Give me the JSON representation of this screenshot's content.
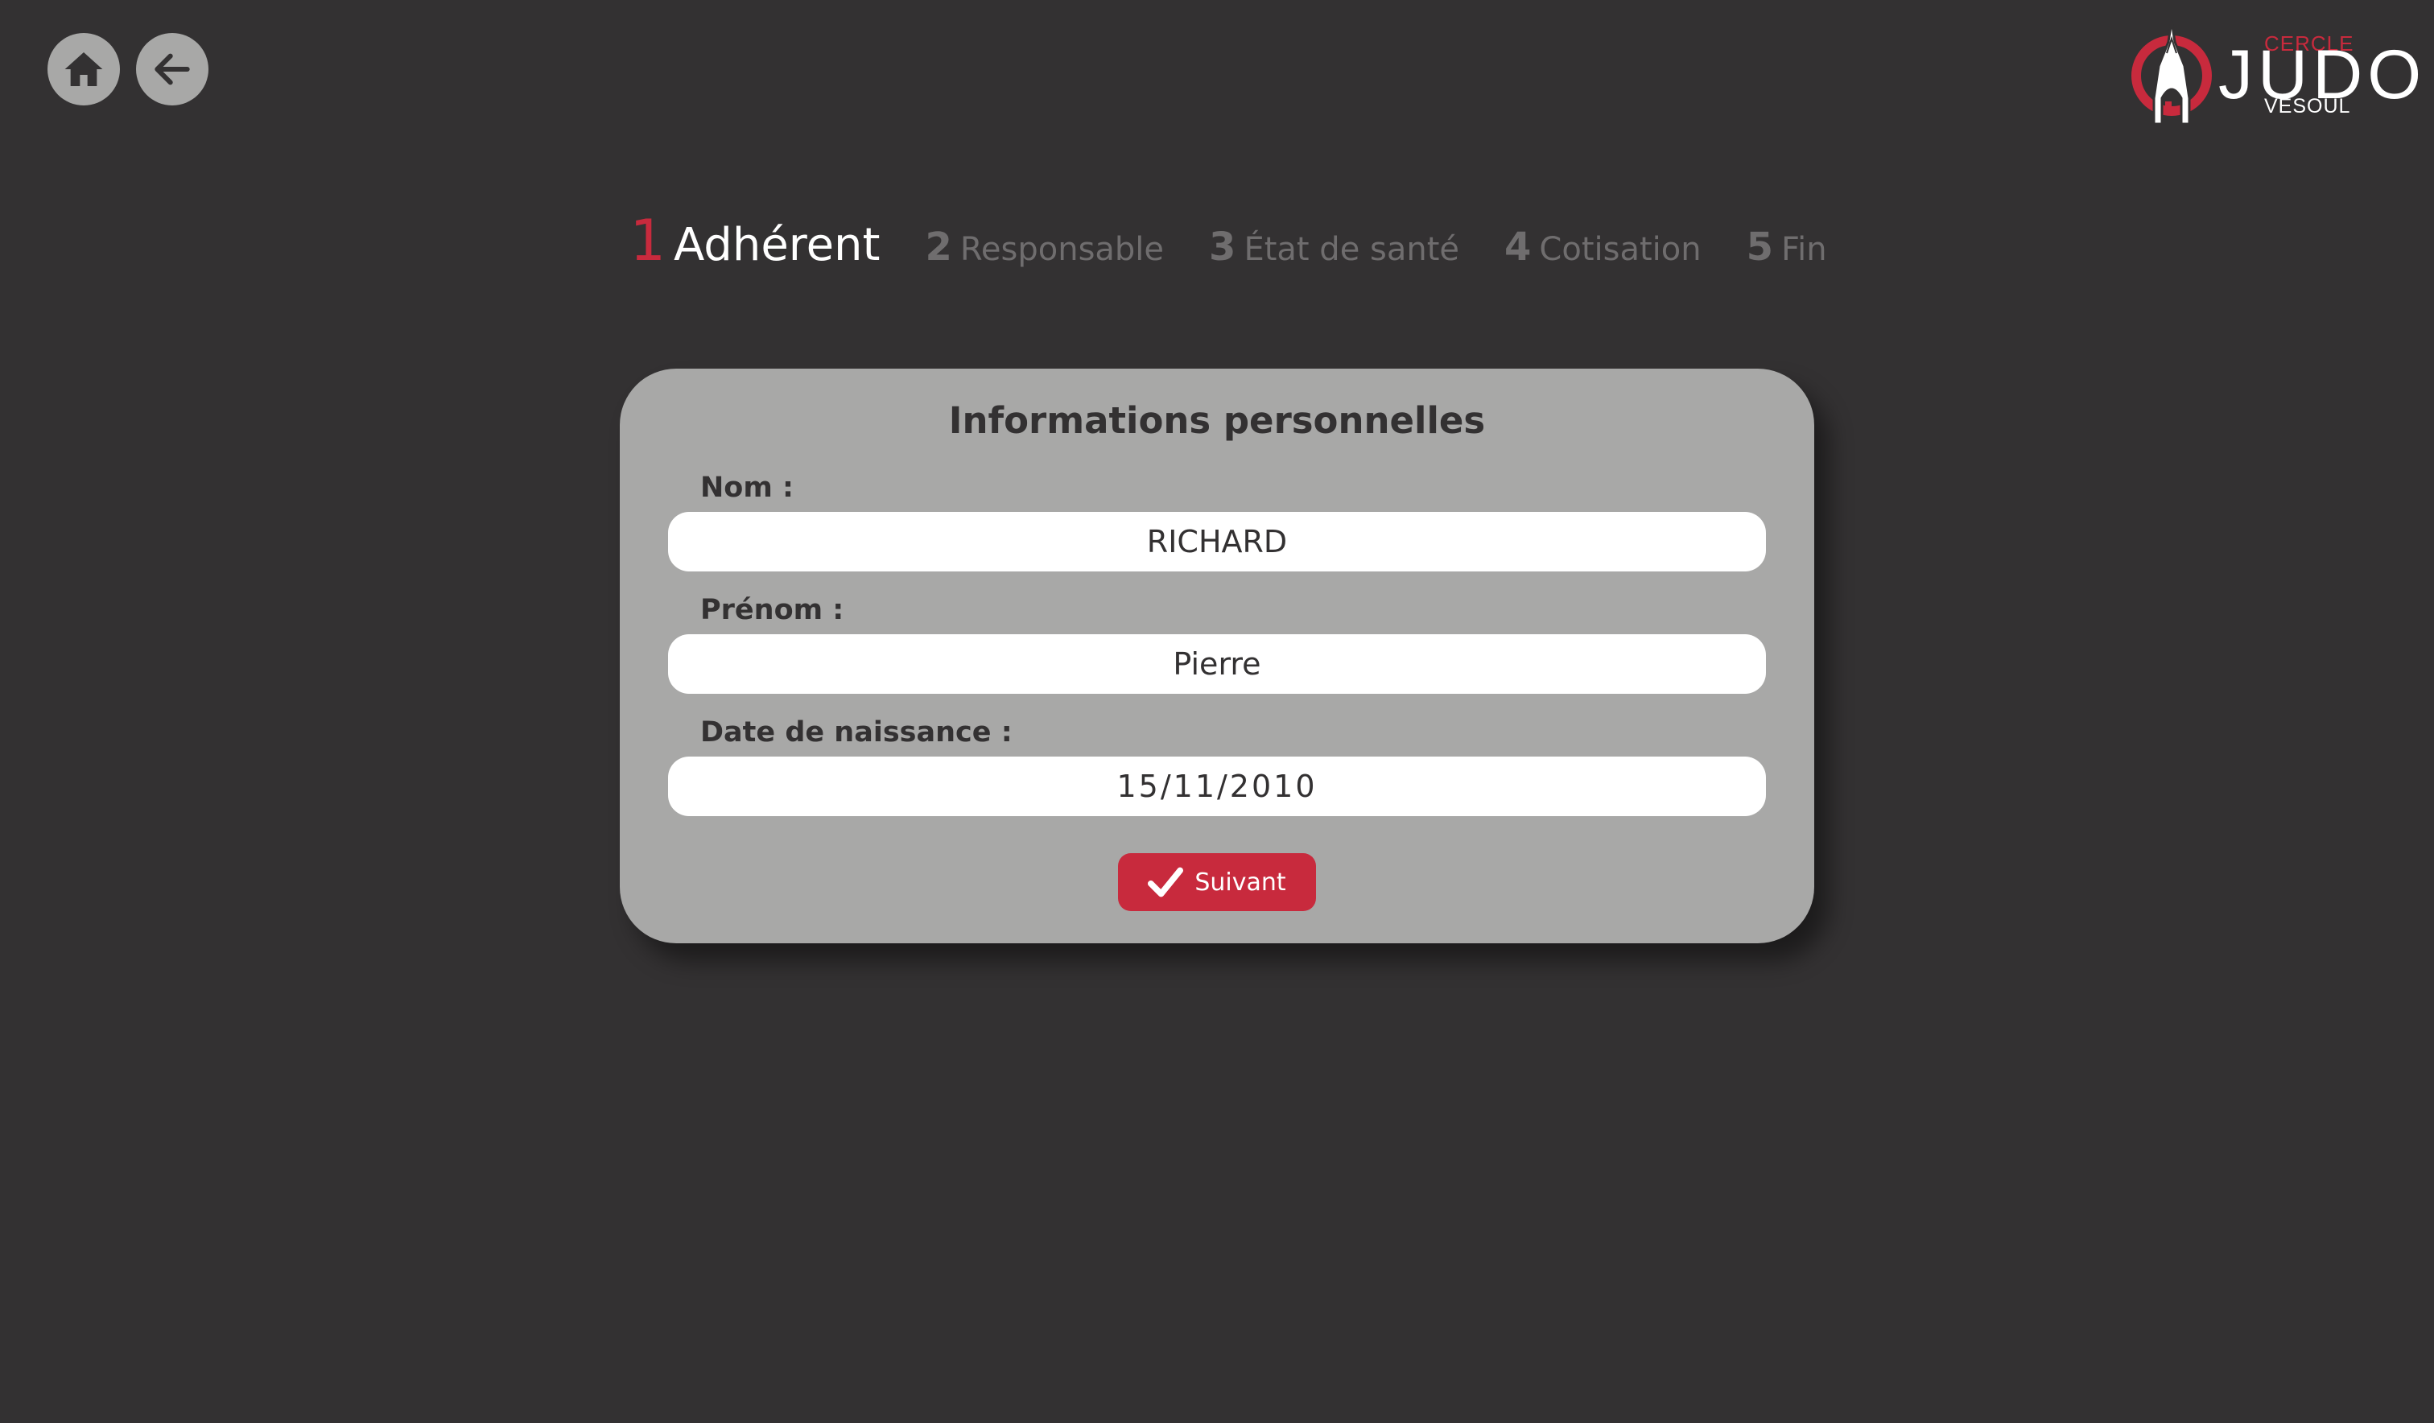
{
  "nav": {
    "home_icon": "home-icon",
    "back_icon": "arrow-left-icon"
  },
  "logo": {
    "line1": "CERCLE",
    "line2": "JUDO",
    "line3": "VESOUL",
    "icon": "cathedral-icon",
    "accent_color": "#c82a3d"
  },
  "steps": [
    {
      "num": "1",
      "label": "Adhérent",
      "active": true
    },
    {
      "num": "2",
      "label": "Responsable",
      "active": false
    },
    {
      "num": "3",
      "label": "État de santé",
      "active": false
    },
    {
      "num": "4",
      "label": "Cotisation",
      "active": false
    },
    {
      "num": "5",
      "label": "Fin",
      "active": false
    }
  ],
  "form": {
    "title": "Informations personnelles",
    "nom_label": "Nom :",
    "nom_value": "RICHARD",
    "prenom_label": "Prénom :",
    "prenom_value": "Pierre",
    "date_label": "Date de naissance :",
    "date_value": "15/11/2010",
    "submit_label": "Suivant",
    "submit_icon": "checkmark-icon"
  },
  "colors": {
    "background": "#333132",
    "card": "#a8a8a7",
    "accent": "#c82a3d",
    "inactive_step": "#6f6d6e"
  }
}
